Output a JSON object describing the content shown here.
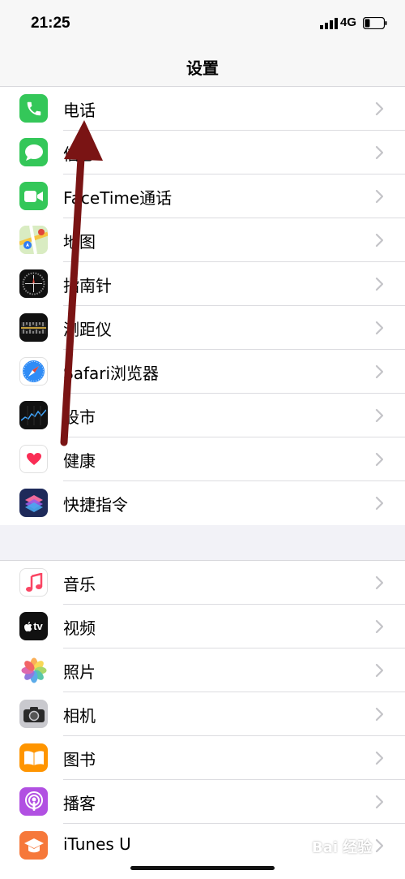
{
  "status": {
    "time": "21:25",
    "network": "4G"
  },
  "nav": {
    "title": "设置"
  },
  "group1": [
    {
      "label": "电话",
      "icon": "phone-icon"
    },
    {
      "label": "信息",
      "icon": "messages-icon"
    },
    {
      "label": "FaceTime通话",
      "icon": "facetime-icon"
    },
    {
      "label": "地图",
      "icon": "maps-icon"
    },
    {
      "label": "指南针",
      "icon": "compass-icon"
    },
    {
      "label": "测距仪",
      "icon": "measure-icon"
    },
    {
      "label": "Safari浏览器",
      "icon": "safari-icon"
    },
    {
      "label": "股市",
      "icon": "stocks-icon"
    },
    {
      "label": "健康",
      "icon": "health-icon"
    },
    {
      "label": "快捷指令",
      "icon": "shortcuts-icon"
    }
  ],
  "group2": [
    {
      "label": "音乐",
      "icon": "music-icon"
    },
    {
      "label": "视频",
      "icon": "tv-icon"
    },
    {
      "label": "照片",
      "icon": "photos-icon"
    },
    {
      "label": "相机",
      "icon": "camera-icon"
    },
    {
      "label": "图书",
      "icon": "books-icon"
    },
    {
      "label": "播客",
      "icon": "podcasts-icon"
    },
    {
      "label": "iTunes U",
      "icon": "itunes-u-icon"
    }
  ],
  "tv_icon_text": "tv",
  "watermark": "Bai 经验"
}
